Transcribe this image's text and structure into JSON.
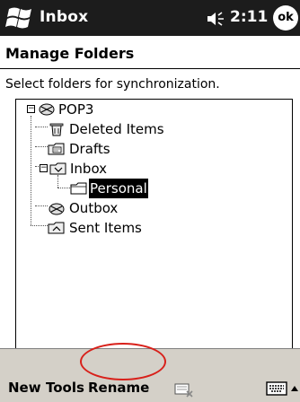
{
  "titlebar": {
    "app_title": "Inbox",
    "time": "2:11",
    "ok_label": "ok",
    "start_icon": "windows-flag-icon",
    "speaker_icon": "speaker-icon"
  },
  "page": {
    "title": "Manage Folders",
    "instruction": "Select folders for synchronization."
  },
  "tree": {
    "nodes": [
      {
        "label": "POP3",
        "icon": "account-icon",
        "expanded": true
      },
      {
        "label": "Deleted Items",
        "icon": "recycle-bin-icon"
      },
      {
        "label": "Drafts",
        "icon": "drafts-folder-icon"
      },
      {
        "label": "Inbox",
        "icon": "inbox-folder-icon",
        "expanded": true
      },
      {
        "label": "Personal",
        "icon": "folder-icon",
        "selected": true
      },
      {
        "label": "Outbox",
        "icon": "outbox-icon"
      },
      {
        "label": "Sent Items",
        "icon": "sent-items-folder-icon"
      }
    ]
  },
  "menubar": {
    "new_label": "New",
    "tools_label": "Tools",
    "rename_label": "Rename",
    "delete_icon": "delete-folder-icon",
    "keyboard_icon": "keyboard-icon",
    "sip_arrow_icon": "up-arrow-icon",
    "highlight_color": "#d8201a"
  }
}
